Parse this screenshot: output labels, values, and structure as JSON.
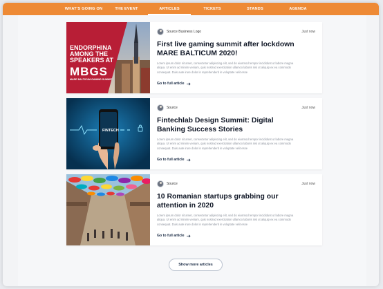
{
  "nav": {
    "items": [
      {
        "label": "WHAT'S GOING ON",
        "active": false
      },
      {
        "label": "THE EVENT",
        "active": false
      },
      {
        "label": "ARTICLES",
        "active": true
      },
      {
        "label": "TICKETS",
        "active": false
      },
      {
        "label": "STANDS",
        "active": false
      },
      {
        "label": "AGENDA",
        "active": false
      }
    ]
  },
  "articles": [
    {
      "source": "Source Business Logo",
      "time": "Just now",
      "title": "First live gaming summit after lockdown MARE BALTICUM 2020!",
      "excerpt": "Lorem ipsum dolor sit amet, consectetur adipiscing elit, sed do eiusmod tempor incididunt ut labore magna aliqua. Ut enim ad minim veniam, quis nostrud exercitation ullamco laboris nisi ut aliquip ex ea commodo consequat. Duis aute irure dolor in reprehenderit in voluptate velit esse",
      "link": "Go to full article",
      "image_text": [
        "ENDORPHINA",
        "AMONG THE",
        "SPEAKERS AT",
        "MBGS",
        "MARE BALTICUM GAMING SUMMIT"
      ]
    },
    {
      "source": "Source",
      "time": "Just now",
      "title": "Fintechlab Design Summit: Digital Banking Success Stories",
      "excerpt": "Lorem ipsum dolor sit amet, consectetur adipiscing elit, sed do eiusmod tempor incididunt ut labore magna aliqua. Ut enim ad minim veniam, quis nostrud exercitation ullamco laboris nisi ut aliquip ex ea commodo consequat. Duis aute irure dolor in reprehenderit in voluptate velit esse",
      "link": "Go to full article",
      "image_text": [
        "FINTECH"
      ]
    },
    {
      "source": "Source",
      "time": "Just now",
      "title": "10 Romanian startups grabbing our attention in 2020",
      "excerpt": "Lorem ipsum dolor sit amet, consectetur adipiscing elit, sed do eiusmod tempor incididunt ut labore magna aliqua. Ut enim ad minim veniam, quis nostrud exercitation ullamco laboris nisi ut aliquip ex ea commodo consequat. Duis aute irure dolor in reprehenderit in voluptate velit esse",
      "link": "Go to full article",
      "image_text": []
    }
  ],
  "show_more": "Show more articles",
  "colors": {
    "nav_bg": "#ee8a35",
    "accent_red": "#b81e36",
    "fintech_blue": "#0a4a78"
  }
}
